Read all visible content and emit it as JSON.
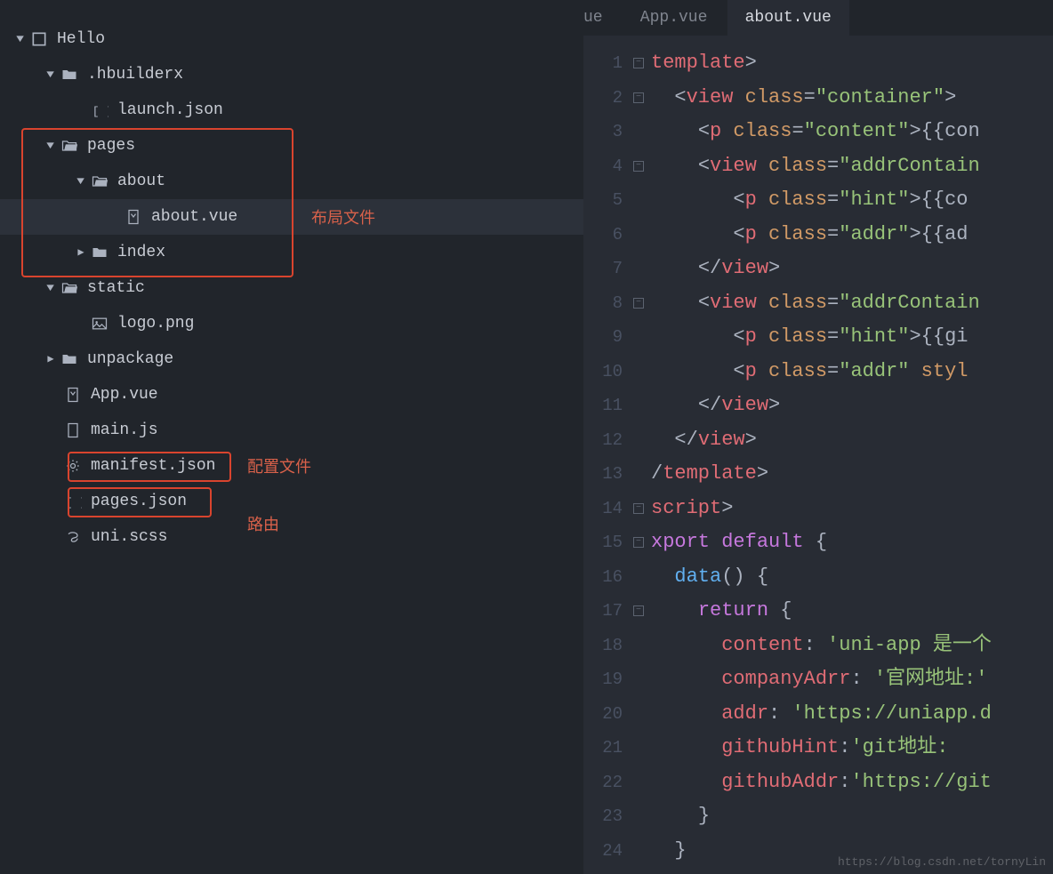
{
  "tabs": [
    {
      "label": "ue",
      "active": false
    },
    {
      "label": "App.vue",
      "active": false
    },
    {
      "label": "about.vue",
      "active": true
    }
  ],
  "tree": {
    "root": {
      "label": "Hello"
    },
    "hbuilderx": {
      "label": ".hbuilderx"
    },
    "launch": {
      "label": "launch.json"
    },
    "pages": {
      "label": "pages"
    },
    "about": {
      "label": "about"
    },
    "aboutvue": {
      "label": "about.vue"
    },
    "index": {
      "label": "index"
    },
    "static": {
      "label": "static"
    },
    "logo": {
      "label": "logo.png"
    },
    "unpackage": {
      "label": "unpackage"
    },
    "appvue": {
      "label": "App.vue"
    },
    "mainjs": {
      "label": "main.js"
    },
    "manifest": {
      "label": "manifest.json"
    },
    "pagesjson": {
      "label": "pages.json"
    },
    "uniscss": {
      "label": "uni.scss"
    }
  },
  "notes": {
    "layout": "布局文件",
    "config": "配置文件",
    "route": "路由"
  },
  "code_lines": [
    {
      "n": 1,
      "fold": "-",
      "html": "<span class='c-red'>template</span><span class='c-white'>&gt;</span>"
    },
    {
      "n": 2,
      "fold": "-",
      "html": "  <span class='c-white'>&lt;</span><span class='c-red'>view</span> <span class='c-orange'>class</span><span class='c-white'>=</span><span class='c-green'>\"container\"</span><span class='c-white'>&gt;</span>"
    },
    {
      "n": 3,
      "fold": "",
      "html": "    <span class='c-white'>&lt;</span><span class='c-red'>p</span> <span class='c-orange'>class</span><span class='c-white'>=</span><span class='c-green'>\"content\"</span><span class='c-white'>&gt;{{con</span>"
    },
    {
      "n": 4,
      "fold": "-",
      "html": "    <span class='c-white'>&lt;</span><span class='c-red'>view</span> <span class='c-orange'>class</span><span class='c-white'>=</span><span class='c-green'>\"addrContain</span>"
    },
    {
      "n": 5,
      "fold": "",
      "html": "       <span class='c-white'>&lt;</span><span class='c-red'>p</span> <span class='c-orange'>class</span><span class='c-white'>=</span><span class='c-green'>\"hint\"</span><span class='c-white'>&gt;{{co</span>"
    },
    {
      "n": 6,
      "fold": "",
      "html": "       <span class='c-white'>&lt;</span><span class='c-red'>p</span> <span class='c-orange'>class</span><span class='c-white'>=</span><span class='c-green'>\"addr\"</span><span class='c-white'>&gt;{{ad</span>"
    },
    {
      "n": 7,
      "fold": "",
      "html": "    <span class='c-white'>&lt;/</span><span class='c-red'>view</span><span class='c-white'>&gt;</span>"
    },
    {
      "n": 8,
      "fold": "-",
      "html": "    <span class='c-white'>&lt;</span><span class='c-red'>view</span> <span class='c-orange'>class</span><span class='c-white'>=</span><span class='c-green'>\"addrContain</span>"
    },
    {
      "n": 9,
      "fold": "",
      "html": "       <span class='c-white'>&lt;</span><span class='c-red'>p</span> <span class='c-orange'>class</span><span class='c-white'>=</span><span class='c-green'>\"hint\"</span><span class='c-white'>&gt;{{gi</span>"
    },
    {
      "n": 10,
      "fold": "",
      "html": "       <span class='c-white'>&lt;</span><span class='c-red'>p</span> <span class='c-orange'>class</span><span class='c-white'>=</span><span class='c-green'>\"addr\"</span> <span class='c-orange'>styl</span>"
    },
    {
      "n": 11,
      "fold": "",
      "html": "    <span class='c-white'>&lt;/</span><span class='c-red'>view</span><span class='c-white'>&gt;</span>"
    },
    {
      "n": 12,
      "fold": "",
      "html": "  <span class='c-white'>&lt;/</span><span class='c-red'>view</span><span class='c-white'>&gt;</span>"
    },
    {
      "n": 13,
      "fold": "",
      "html": "<span class='c-white'>/</span><span class='c-red'>template</span><span class='c-white'>&gt;</span>"
    },
    {
      "n": 14,
      "fold": "-",
      "html": "<span class='c-red'>script</span><span class='c-white'>&gt;</span>"
    },
    {
      "n": 15,
      "fold": "-",
      "html": "<span class='c-purple'>xport</span> <span class='c-purple'>default</span> <span class='c-white'>{</span>"
    },
    {
      "n": 16,
      "fold": "",
      "html": "  <span class='c-blue'>data</span><span class='c-white'>() {</span>"
    },
    {
      "n": 17,
      "fold": "-",
      "html": "    <span class='c-purple'>return</span> <span class='c-white'>{</span>"
    },
    {
      "n": 18,
      "fold": "",
      "html": "      <span class='c-red'>content</span><span class='c-white'>:</span> <span class='c-green'>'uni-app 是一个</span>"
    },
    {
      "n": 19,
      "fold": "",
      "html": "      <span class='c-red'>companyAdrr</span><span class='c-white'>:</span> <span class='c-green'>'官网地址:'</span>"
    },
    {
      "n": 20,
      "fold": "",
      "html": "      <span class='c-red'>addr</span><span class='c-white'>:</span> <span class='c-green'>'https://uniapp.d</span>"
    },
    {
      "n": 21,
      "fold": "",
      "html": "      <span class='c-red'>githubHint</span><span class='c-white'>:</span><span class='c-green'>'git地址:</span>"
    },
    {
      "n": 22,
      "fold": "",
      "html": "      <span class='c-red'>githubAddr</span><span class='c-white'>:</span><span class='c-green'>'https://git</span>"
    },
    {
      "n": 23,
      "fold": "",
      "html": "    <span class='c-white'>}</span>"
    },
    {
      "n": 24,
      "fold": "",
      "html": "  <span class='c-white'>}</span>"
    }
  ],
  "watermark": "https://blog.csdn.net/tornyLin"
}
